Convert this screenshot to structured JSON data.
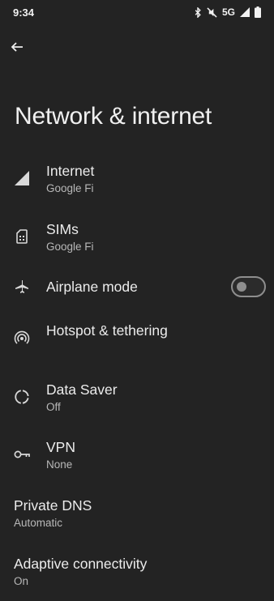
{
  "status_bar": {
    "time": "9:34",
    "network": "5G"
  },
  "header": {
    "title": "Network & internet"
  },
  "items": [
    {
      "label": "Internet",
      "sublabel": "Google Fi",
      "icon": "signal-icon"
    },
    {
      "label": "SIMs",
      "sublabel": "Google Fi",
      "icon": "sim-card-icon"
    },
    {
      "label": "Airplane mode",
      "icon": "airplane-icon",
      "toggle_on": false
    },
    {
      "label": "Hotspot & tethering",
      "icon": "hotspot-icon"
    },
    {
      "label": "Data Saver",
      "sublabel": "Off",
      "icon": "data-saver-icon"
    },
    {
      "label": "VPN",
      "sublabel": "None",
      "icon": "key-icon"
    },
    {
      "label": "Private DNS",
      "sublabel": "Automatic"
    },
    {
      "label": "Adaptive connectivity",
      "sublabel": "On"
    }
  ],
  "colors": {
    "background": "#232323",
    "text": "#ececec",
    "subtext": "#b8b8b8",
    "toggle_off": "#8e8e8e"
  }
}
